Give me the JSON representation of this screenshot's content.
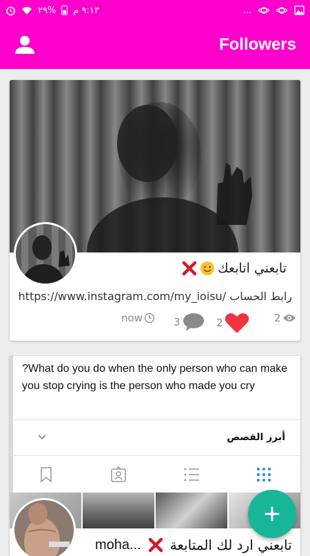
{
  "status_bar": {
    "time": "٩:١٣ م",
    "battery": "%٢٩",
    "more": "..."
  },
  "app_bar": {
    "title": "Followers",
    "profile_icon": "person-icon"
  },
  "post1": {
    "title": "تابعني اتابعك",
    "link_label": "رابط الحساب",
    "link_url": "https://www.instagram.com/my_ioisu/",
    "time": "now",
    "comments": "3",
    "likes": "2",
    "views": "2"
  },
  "post2": {
    "text": "?What do you do when the only person who can make you stop crying is the person who made you cry",
    "highlights_label": "أبرز القصص",
    "title": "تابعني ارد لك المتابعة",
    "username": "moha..."
  },
  "colors": {
    "accent": "#ff00cc",
    "fab": "#17b59a",
    "like": "#f0353f",
    "highlight_icon": "#2a85d8"
  }
}
